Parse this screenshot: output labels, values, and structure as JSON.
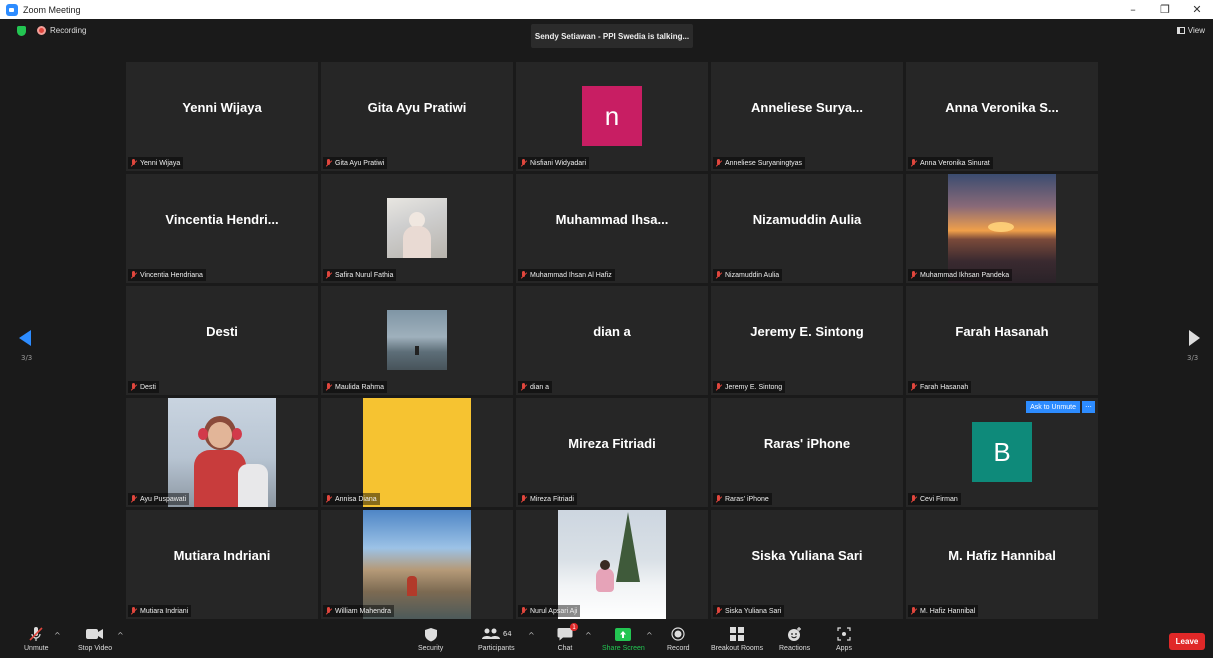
{
  "window": {
    "title": "Zoom Meeting",
    "controls": [
      "–",
      "❐",
      "✕"
    ]
  },
  "topbar": {
    "recording_label": "Recording",
    "talking_text": "Sendy Setiawan - PPI Swedia is talking...",
    "view_label": "View"
  },
  "pager": {
    "left": "3/3",
    "right": "3/3"
  },
  "tiles": [
    {
      "name": "Yenni Wijaya",
      "display": "Yenni Wijaya"
    },
    {
      "name": "Gita Ayu Pratiwi",
      "display": "Gita Ayu Pratiwi"
    },
    {
      "name": "Nisfiani Widyadari",
      "display": "",
      "avatar_letter": "n",
      "avatar_color": "#c81e63"
    },
    {
      "name": "Anneliese Suryaningtyas",
      "display": "Anneliese Surya..."
    },
    {
      "name": "Anna Veronika Sinurat",
      "display": "Anna Veronika S..."
    },
    {
      "name": "Vincentia Hendriana",
      "display": "Vincentia Hendri..."
    },
    {
      "name": "Safira Nurul Fathia",
      "display": "",
      "photo": "safira"
    },
    {
      "name": "Muhammad Ihsan Al Hafiz",
      "display": "Muhammad Ihsa..."
    },
    {
      "name": "Nizamuddin Aulia",
      "display": "Nizamuddin Aulia"
    },
    {
      "name": "Muhammad Ikhsan Pandeka",
      "display": "",
      "photo": "sunset"
    },
    {
      "name": "Desti",
      "display": "Desti"
    },
    {
      "name": "Maulida Rahma",
      "display": "",
      "photo": "seaside"
    },
    {
      "name": "dian a",
      "display": "dian a"
    },
    {
      "name": "Jeremy E. Sintong",
      "display": "Jeremy E. Sintong"
    },
    {
      "name": "Farah Hasanah",
      "display": "Farah Hasanah"
    },
    {
      "name": "Ayu Puspawati",
      "display": "",
      "photo": "ayu"
    },
    {
      "name": "Annisa Diana",
      "display": "",
      "photo": "yellow"
    },
    {
      "name": "Mireza Fitriadi",
      "display": "Mireza Fitriadi"
    },
    {
      "name": "Raras' iPhone",
      "display": "Raras' iPhone"
    },
    {
      "name": "Cevi Firman",
      "display": "",
      "avatar_letter": "B",
      "avatar_color": "#0e8a7a",
      "ask_unmute": "Ask to Unmute",
      "more": "···"
    },
    {
      "name": "Mutiara Indriani",
      "display": "Mutiara Indriani"
    },
    {
      "name": "William Mahendra",
      "display": "",
      "photo": "hills"
    },
    {
      "name": "Nurul Apsari Aji",
      "display": "",
      "photo": "snow"
    },
    {
      "name": "Siska Yuliana Sari",
      "display": "Siska Yuliana Sari"
    },
    {
      "name": "M. Hafiz Hannibal",
      "display": "M. Hafiz Hannibal"
    }
  ],
  "toolbar": {
    "unmute": "Unmute",
    "stop_video": "Stop Video",
    "security": "Security",
    "participants": "Participants",
    "participants_count": "64",
    "chat": "Chat",
    "chat_badge": "1",
    "share_screen": "Share Screen",
    "record": "Record",
    "breakout": "Breakout Rooms",
    "reactions": "Reactions",
    "apps": "Apps",
    "leave": "Leave"
  },
  "colors": {
    "accent": "#2d8cff",
    "leave": "#e02828",
    "share": "#23c552",
    "muted": "#e0463d"
  }
}
